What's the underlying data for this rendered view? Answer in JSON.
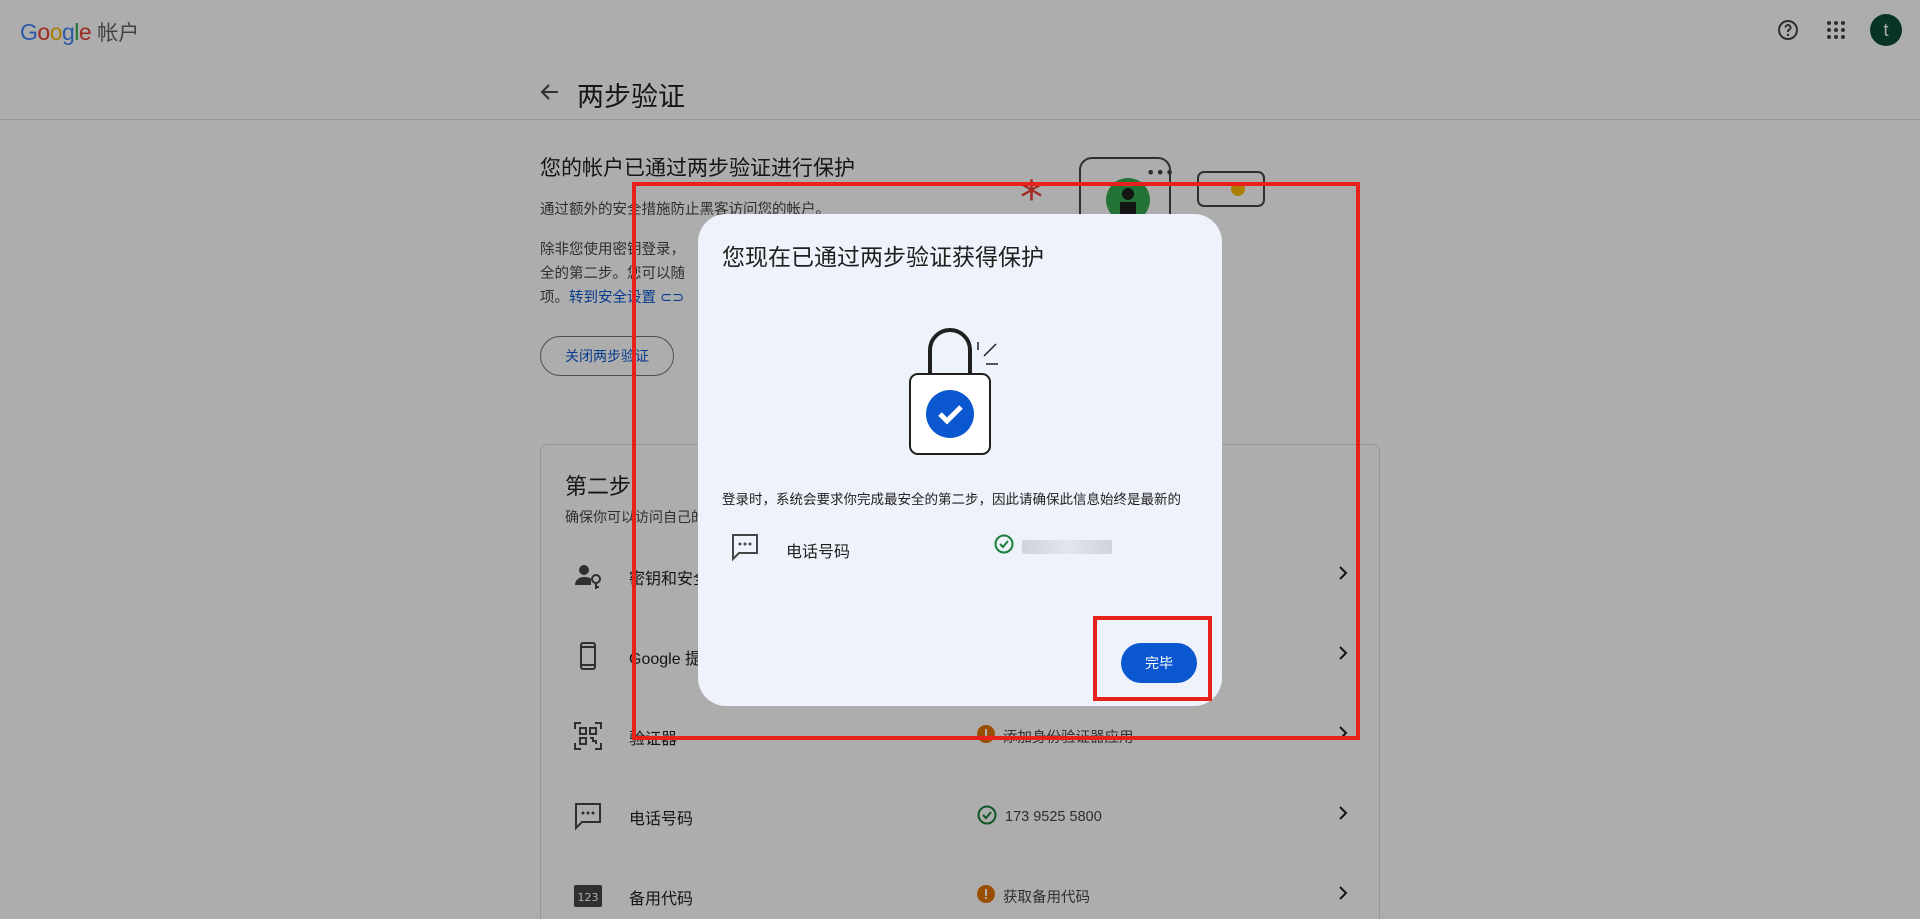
{
  "topbar": {
    "logo_letters": [
      "G",
      "o",
      "o",
      "g",
      "l",
      "e"
    ],
    "product": "帐户",
    "avatar_letter": "t"
  },
  "header": {
    "title": "两步验证"
  },
  "hero": {
    "title": "您的帐户已通过两步验证进行保护",
    "desc1": "通过额外的安全措施防止黑客访问您的帐户。",
    "desc2_part1": "除非您使用密钥登录，",
    "desc2_part2": "全的第二步。您可以随",
    "desc2_part3": "项。",
    "link": "转到安全设置",
    "turnoff_button": "关闭两步验证"
  },
  "second_step": {
    "title": "第二步",
    "subtitle": "确保你可以访问自己的",
    "rows": [
      {
        "label": "密钥和安全",
        "status": "",
        "icon": "person-key-icon"
      },
      {
        "label": "Google 提",
        "status": "",
        "icon": "phone-icon"
      },
      {
        "label": "验证器",
        "status": "添加身份验证器应用",
        "status_type": "warning",
        "icon": "qr-icon"
      },
      {
        "label": "电话号码",
        "status": "173 9525 5800",
        "status_type": "ok",
        "icon": "sms-icon"
      },
      {
        "label": "备用代码",
        "status": "获取备用代码",
        "status_type": "warning",
        "icon": "backup-codes-icon"
      }
    ]
  },
  "dialog": {
    "title": "您现在已通过两步验证获得保护",
    "description": "登录时，系统会要求你完成最安全的第二步，因此请确保此信息始终是最新的",
    "row_label": "电话号码",
    "done_button": "完毕"
  },
  "colors": {
    "primary": "#0b57d0",
    "annotation": "#e8211d",
    "ok": "#188038",
    "warning": "#e37400"
  }
}
